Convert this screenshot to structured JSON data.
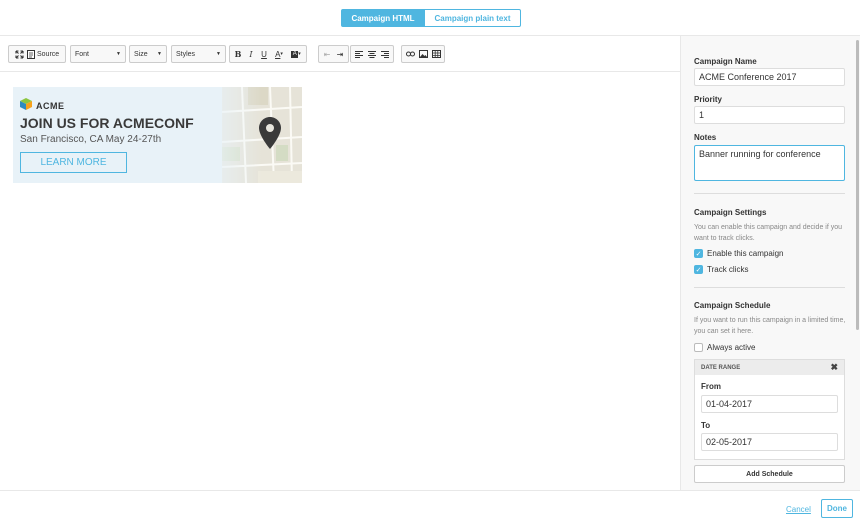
{
  "header": {
    "tabs": [
      {
        "label": "Campaign HTML",
        "active": true
      },
      {
        "label": "Campaign plain text",
        "active": false
      }
    ]
  },
  "toolbar": {
    "source_label": "Source",
    "font_label": "Font",
    "size_label": "Size",
    "styles_label": "Styles",
    "icons": [
      "maximize-icon",
      "source-icon",
      "bold-icon",
      "italic-icon",
      "underline-icon",
      "text-color-icon",
      "background-color-icon",
      "outdent-icon",
      "indent-icon",
      "align-left-icon",
      "align-center-icon",
      "align-right-icon",
      "link-icon",
      "image-icon",
      "table-icon"
    ]
  },
  "banner": {
    "brand": "ACME",
    "headline": "JOIN US FOR ACMECONF",
    "subline": "San Francisco, CA May 24-27th",
    "cta": "LEARN MORE"
  },
  "panel": {
    "name_label": "Campaign Name",
    "name_value": "ACME Conference 2017",
    "priority_label": "Priority",
    "priority_value": "1",
    "notes_label": "Notes",
    "notes_value": "Banner running for conference",
    "settings_title": "Campaign Settings",
    "settings_help": "You can enable this campaign and decide if you want to track clicks.",
    "enable_label": "Enable this campaign",
    "track_label": "Track clicks",
    "schedule_title": "Campaign Schedule",
    "schedule_help": "If you want to run this campaign in a limited time, you can set it here.",
    "always_label": "Always active",
    "date_range_title": "DATE RANGE",
    "from_label": "From",
    "from_value": "01-04-2017",
    "to_label": "To",
    "to_value": "02-05-2017",
    "add_schedule": "Add Schedule"
  },
  "footer": {
    "cancel": "Cancel",
    "done": "Done"
  },
  "colors": {
    "accent": "#4fb6e0"
  }
}
